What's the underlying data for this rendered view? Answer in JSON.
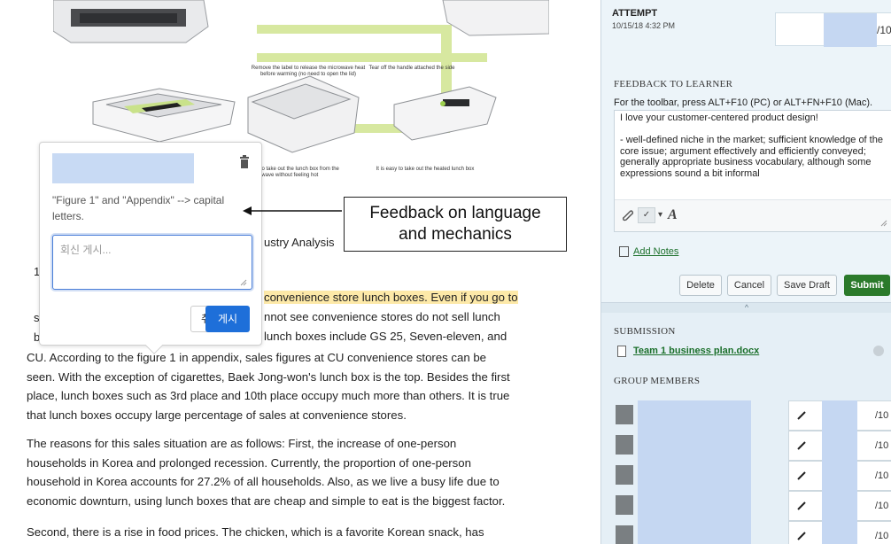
{
  "figure": {
    "captions": [
      "Remove the label to release the microwave heat before warming (no need to open the lid)",
      "Tear off the handle attached the side",
      "Bottom helps to take out the lunch box from the microwave without feeling hot",
      "It is easy to take out the heated lunch box"
    ]
  },
  "document": {
    "heading_fragment": "ustry Analysis",
    "paragraph1": [
      "convenience store lunch boxes. Even if you go to",
      "nnot see convenience stores do not sell lunch",
      "lunch boxes include GS 25, Seven-eleven, and",
      "CU. According to the figure 1 in appendix, sales figures at CU convenience stores can be",
      "seen. With the exception of cigarettes, Baek Jong-won's lunch box is the top. Besides the first",
      "place, lunch boxes such as 3rd place and 10th place occupy much more than others. It is true",
      "that lunch boxes occupy large percentage of sales at convenience stores."
    ],
    "paragraph2": [
      " The reasons for this sales situation are as follows: First, the increase of one-person",
      "households in Korea and prolonged recession. Currently, the proportion of one-person",
      "household in Korea accounts for 27.2% of all households. Also, as we live a busy life due to",
      "economic downturn, using lunch boxes that are cheap and simple to eat is the biggest factor."
    ],
    "paragraph3": [
      " Second, there is a rise in food prices. The chicken, which is a favorite Korean snack, has"
    ],
    "stray_letters": [
      "1",
      "s",
      "b"
    ]
  },
  "comment": {
    "text": "\"Figure 1\" and \"Appendix\" --> capital letters.",
    "reply_placeholder": "회신 게시...",
    "cancel_label": "취소",
    "post_label": "게시"
  },
  "annotation": {
    "line1": "Feedback on language",
    "line2": "and mechanics"
  },
  "panel": {
    "attempt_label": "ATTEMPT",
    "attempt_date": "10/15/18 4:32 PM",
    "grade_suffix": "/10",
    "feedback_label": "FEEDBACK TO LEARNER",
    "toolbar_hint": "For the toolbar, press ALT+F10 (PC) or ALT+FN+F10 (Mac).",
    "feedback_p1": "I love your customer-centered product design!",
    "feedback_p2": "- well-defined niche in the market; sufficient knowledge of the core issue; argument effectively and efficiently conveyed; generally appropriate business vocabulary, although some expressions sound a bit informal",
    "add_notes": "Add Notes",
    "buttons": {
      "delete": "Delete",
      "cancel": "Cancel",
      "save_draft": "Save Draft",
      "submit": "Submit"
    },
    "collapse_glyph": "^",
    "submission_label": "SUBMISSION",
    "file_name": "Team 1 business plan.docx",
    "group_label": "GROUP MEMBERS",
    "member_suffix": "/10",
    "member_count": 5
  },
  "colors": {
    "highlight": "#fde9a8",
    "post_button": "#1e6fd9",
    "submit_button": "#2b7a2b",
    "link_green": "#1a6f2a",
    "redaction": "#c5d7f2"
  }
}
